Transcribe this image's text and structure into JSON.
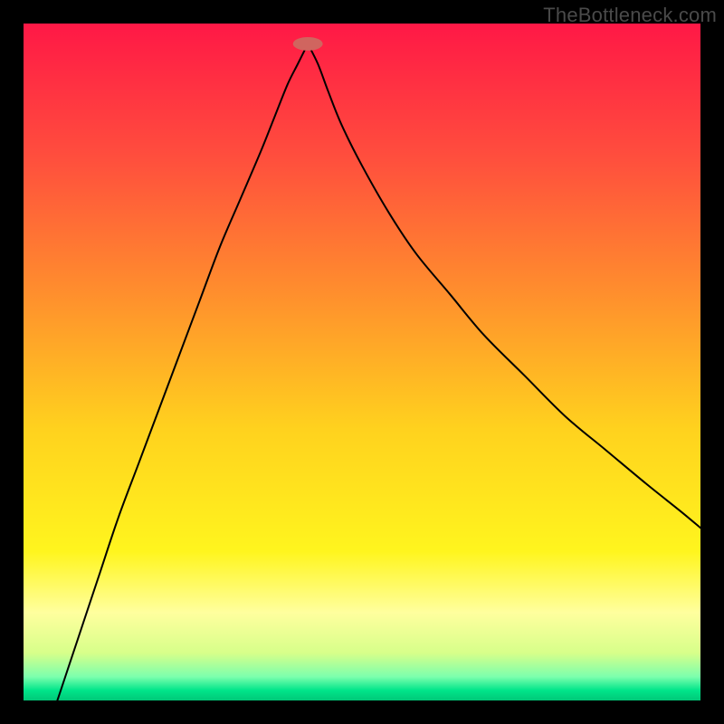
{
  "watermark": "TheBottleneck.com",
  "chart_data": {
    "type": "line",
    "title": "",
    "xlabel": "",
    "ylabel": "",
    "xlim": [
      0,
      100
    ],
    "ylim": [
      0,
      100
    ],
    "grid": false,
    "legend": false,
    "background_gradient": {
      "stops": [
        {
          "offset": 0.0,
          "color": "#ff1846"
        },
        {
          "offset": 0.2,
          "color": "#ff4f3d"
        },
        {
          "offset": 0.4,
          "color": "#ff8f2d"
        },
        {
          "offset": 0.6,
          "color": "#ffd21e"
        },
        {
          "offset": 0.78,
          "color": "#fff51e"
        },
        {
          "offset": 0.87,
          "color": "#ffff9e"
        },
        {
          "offset": 0.93,
          "color": "#d7ff8a"
        },
        {
          "offset": 0.965,
          "color": "#7cffad"
        },
        {
          "offset": 0.985,
          "color": "#00e58a"
        },
        {
          "offset": 1.0,
          "color": "#00c878"
        }
      ]
    },
    "vertex": {
      "x": 42,
      "y": 97
    },
    "marker": {
      "x": 42,
      "y": 97,
      "color": "#d0655f",
      "rx": 2.2,
      "ry": 1.0
    },
    "series": [
      {
        "name": "left-branch",
        "x": [
          5,
          8,
          11,
          14,
          17,
          20,
          23,
          26,
          29,
          32,
          35,
          37,
          39,
          40.5,
          42
        ],
        "values": [
          0,
          9,
          18,
          27,
          35,
          43,
          51,
          59,
          67,
          74,
          81,
          86,
          91,
          94,
          97
        ]
      },
      {
        "name": "right-branch",
        "x": [
          42,
          43.5,
          45,
          47,
          50,
          54,
          58,
          63,
          68,
          74,
          80,
          86,
          92,
          97,
          100
        ],
        "values": [
          97,
          94,
          90,
          85,
          79,
          72,
          66,
          60,
          54,
          48,
          42,
          37,
          32,
          28,
          25.5
        ]
      }
    ]
  }
}
